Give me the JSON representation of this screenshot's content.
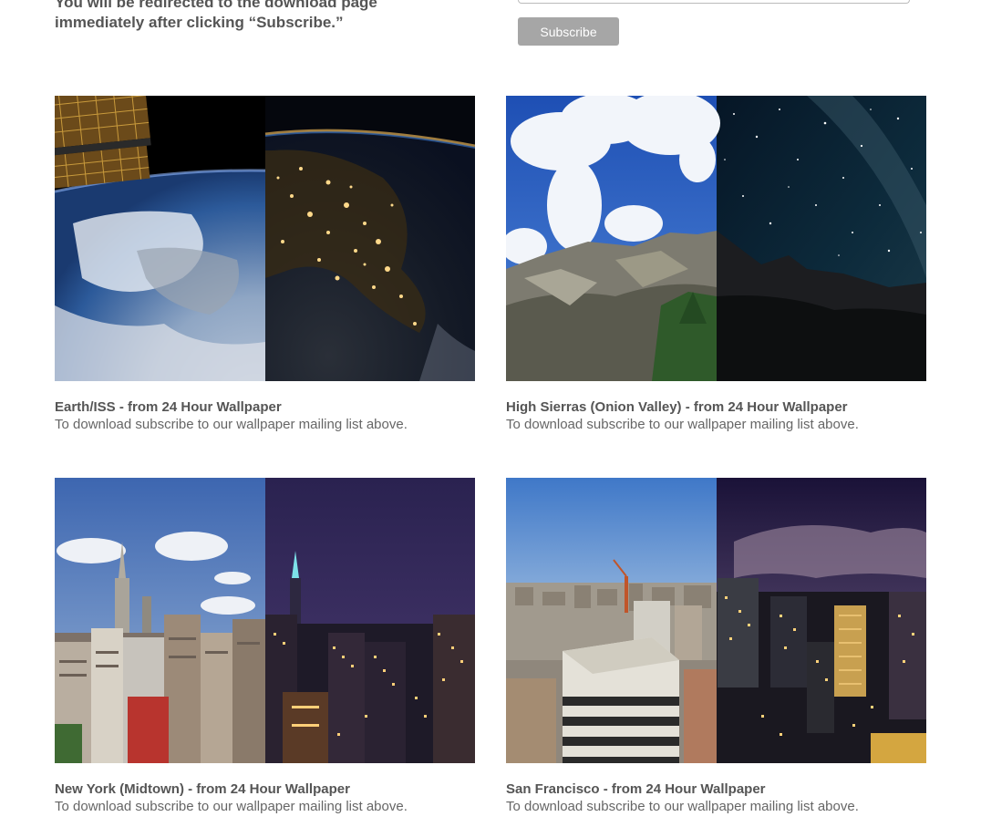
{
  "subscribe": {
    "intro_line1": "You will be redirected to the download page",
    "intro_line2": "immediately after clicking “Subscribe.”",
    "button_label": "Subscribe"
  },
  "wallpapers": [
    {
      "title": "Earth/ISS - from 24 Hour Wallpaper",
      "description": "To download subscribe to our wallpaper mailing list above.",
      "image": "earth-iss-day-night-image"
    },
    {
      "title": "High Sierras (Onion Valley) - from 24 Hour Wallpaper",
      "description": "To download subscribe to our wallpaper mailing list above.",
      "image": "high-sierras-day-night-image"
    },
    {
      "title": "New York (Midtown) - from 24 Hour Wallpaper",
      "description": "To download subscribe to our wallpaper mailing list above.",
      "image": "new-york-day-night-image"
    },
    {
      "title": "San Francisco - from 24 Hour Wallpaper",
      "description": "To download subscribe to our wallpaper mailing list above.",
      "image": "san-francisco-day-night-image"
    }
  ]
}
